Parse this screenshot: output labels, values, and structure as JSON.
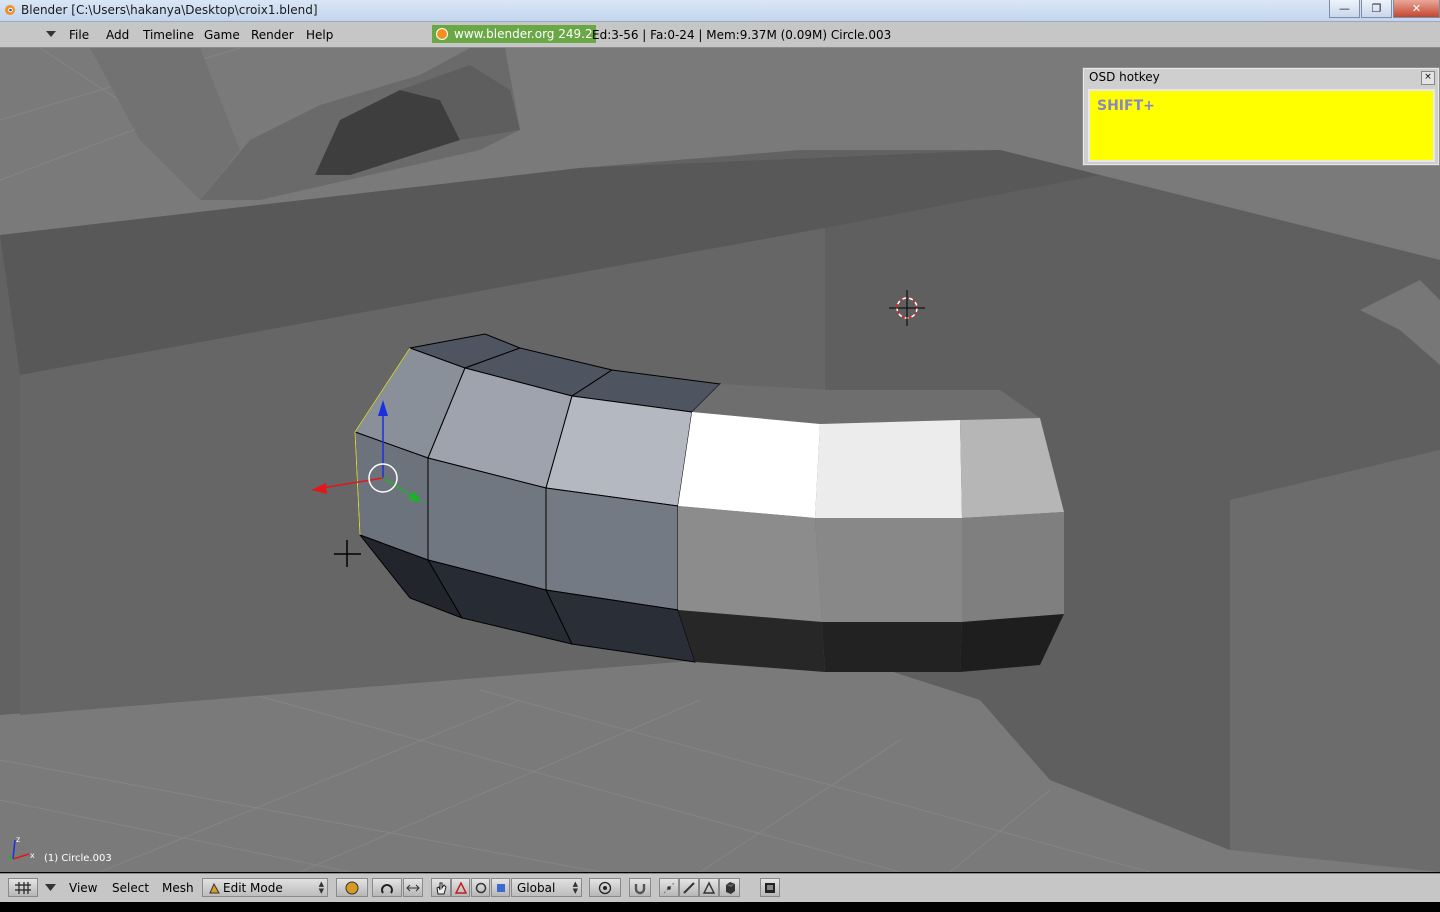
{
  "window": {
    "title": "Blender [C:\\Users\\hakanya\\Desktop\\croix1.blend]",
    "controls": {
      "minimize": "—",
      "maximize": "❐",
      "close": "✕"
    }
  },
  "menubar": {
    "items": [
      "File",
      "Add",
      "Timeline",
      "Game",
      "Render",
      "Help"
    ],
    "web_link": "www.blender.org 249.2",
    "stats": "Ed:3-56 | Fa:0-24 | Mem:9.37M (0.09M) Circle.003"
  },
  "osd": {
    "title": "OSD hotkey",
    "close": "×",
    "text": "SHIFT+"
  },
  "viewport": {
    "object_label": "(1) Circle.003",
    "axis_labels": {
      "z": "z",
      "x": "x"
    }
  },
  "bottombar": {
    "menus": [
      "View",
      "Select",
      "Mesh"
    ],
    "mode": "Edit Mode",
    "orientation": "Global"
  },
  "colors": {
    "menubar_bg": "#c6c6c6",
    "viewport_bg": "#7a7a7a",
    "osd_body": "#ffff00",
    "weblink_bg": "#6aa846",
    "axis_x": "#e0181b",
    "axis_y": "#1fb02b",
    "axis_z": "#1b2fe0"
  }
}
